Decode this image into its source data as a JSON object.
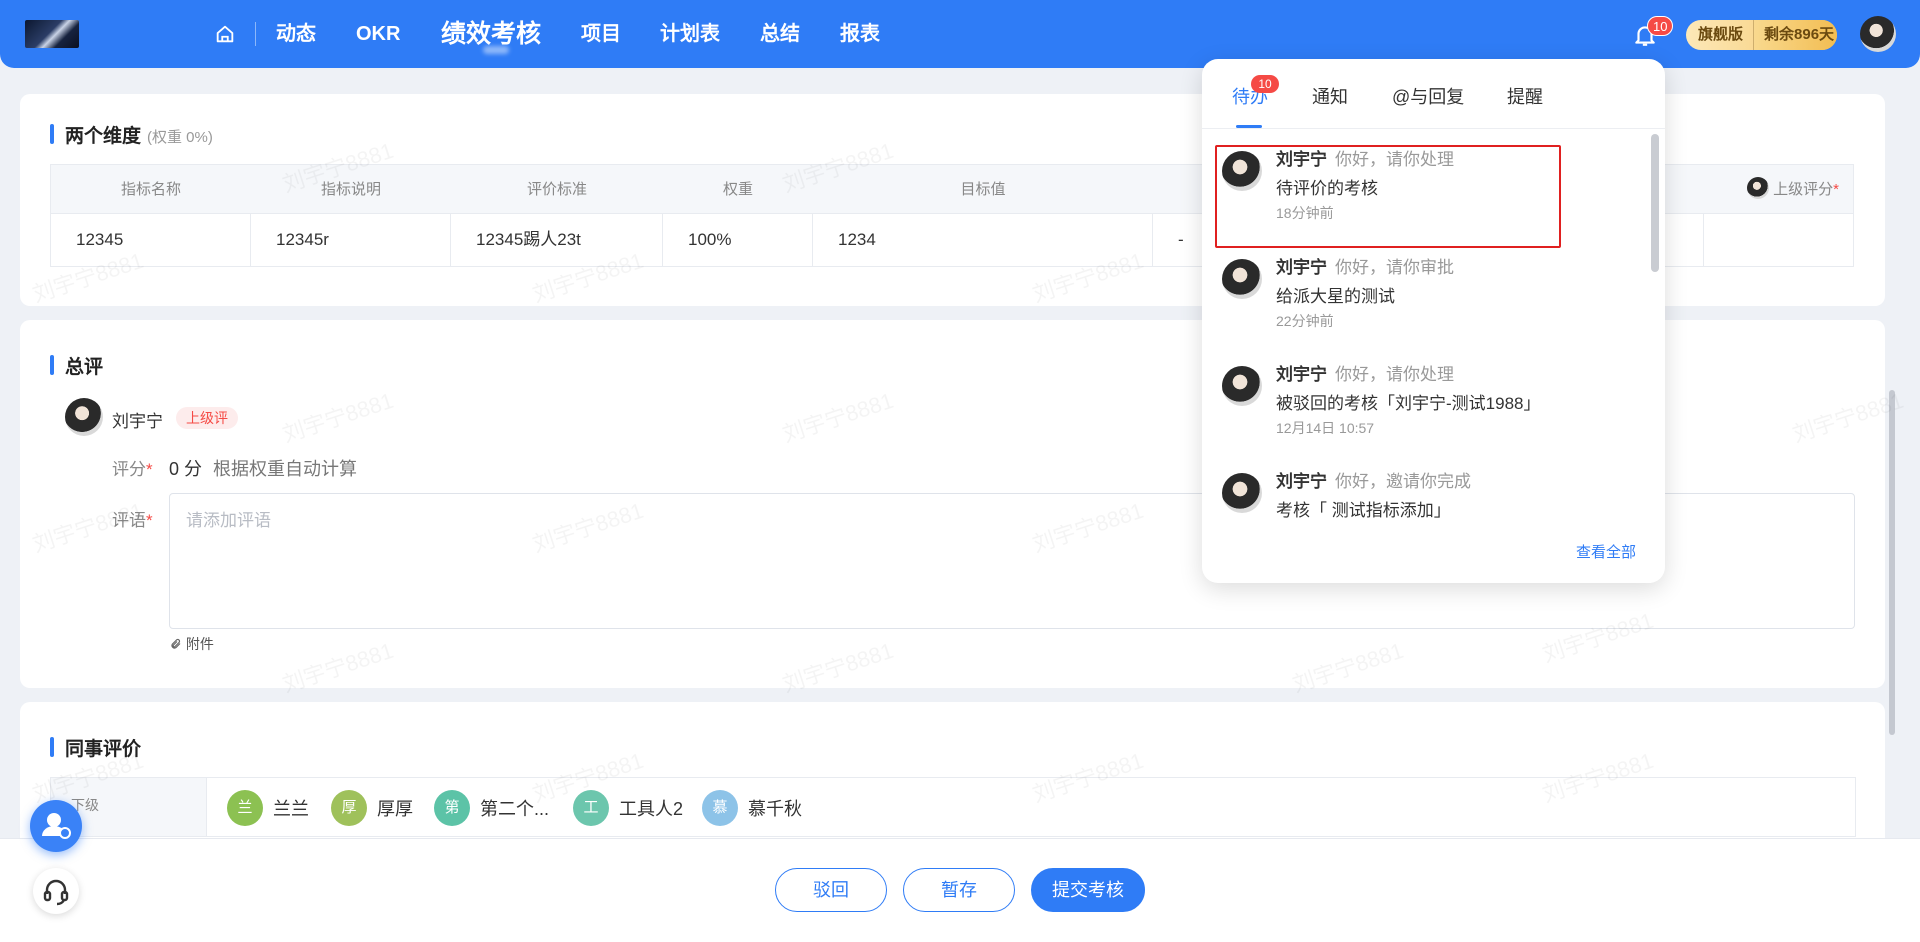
{
  "nav": {
    "items": [
      "动态",
      "OKR",
      "绩效考核",
      "项目",
      "计划表",
      "总结",
      "报表"
    ],
    "active": "绩效考核",
    "notification_count": "10",
    "plan_name": "旗舰版",
    "plan_remaining": "剩余896天"
  },
  "dimension": {
    "title": "两个维度",
    "weight_note": "(权重 0%)",
    "columns": [
      "指标名称",
      "指标说明",
      "评价标准",
      "权重",
      "目标值",
      "上级评分"
    ],
    "row": [
      "12345",
      "12345r",
      "12345踢人23t",
      "100%",
      "1234",
      "-"
    ]
  },
  "overall": {
    "title": "总评",
    "evaluator": "刘宇宁",
    "evaluator_tag": "上级评",
    "score_label": "评分",
    "score_value": "0 分",
    "score_hint": "根据权重自动计算",
    "comment_label": "评语",
    "comment_placeholder": "请添加评语",
    "attachment_label": "附件"
  },
  "peers": {
    "title": "同事评价",
    "row_label": "下级",
    "people": [
      {
        "initial": "兰",
        "name": "兰兰",
        "color": "#8cc152"
      },
      {
        "initial": "厚",
        "name": "厚厚",
        "color": "#9fc15b"
      },
      {
        "initial": "第",
        "name": "第二个...",
        "color": "#5cc3a7"
      },
      {
        "initial": "工",
        "name": "工具人2",
        "color": "#6cc6ad"
      },
      {
        "initial": "慕",
        "name": "慕千秋",
        "color": "#8dc3e8"
      }
    ]
  },
  "actions": {
    "reject": "驳回",
    "save_draft": "暂存",
    "submit": "提交考核"
  },
  "popover": {
    "tabs": [
      "待办",
      "通知",
      "@与回复",
      "提醒"
    ],
    "active_tab": "待办",
    "todo_badge": "10",
    "items": [
      {
        "name": "刘宇宁",
        "action": "你好，请你处理",
        "message": "待评价的考核",
        "time": "18分钟前"
      },
      {
        "name": "刘宇宁",
        "action": "你好，请你审批",
        "message": "给派大星的测试",
        "time": "22分钟前"
      },
      {
        "name": "刘宇宁",
        "action": "你好，请你处理",
        "message": "被驳回的考核「刘宇宁-测试1988」",
        "time": "12月14日 10:57"
      },
      {
        "name": "刘宇宁",
        "action": "你好，邀请你完成",
        "message": "考核「 测试指标添加」",
        "time": ""
      }
    ],
    "view_all": "查看全部"
  },
  "watermark": "刘宇宁8881",
  "colors": {
    "primary": "#2f7cf6",
    "danger": "#f54a45"
  }
}
